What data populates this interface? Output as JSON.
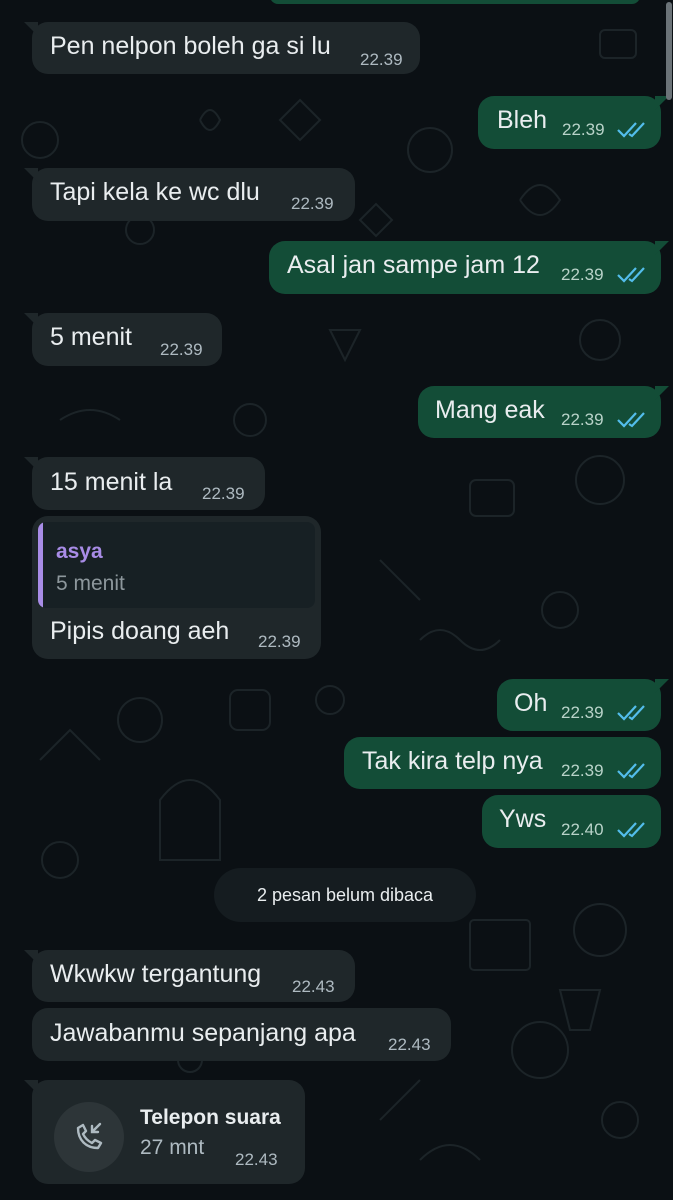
{
  "colors": {
    "background": "#0b1014",
    "incoming_bubble": "#1f272a",
    "outgoing_bubble": "#134d37",
    "read_ticks": "#53bdeb",
    "quote_accent": "#a88ce6"
  },
  "messages": [
    {
      "text": "Pen nelpon boleh ga si lu",
      "time": "22.39"
    },
    {
      "text": "Bleh",
      "time": "22.39"
    },
    {
      "text": "Tapi kela ke wc dlu",
      "time": "22.39"
    },
    {
      "text": "Asal jan sampe jam 12",
      "time": "22.39"
    },
    {
      "text": "5 menit",
      "time": "22.39"
    },
    {
      "text": "Mang eak",
      "time": "22.39"
    },
    {
      "text": "15 menit la",
      "time": "22.39"
    },
    {
      "quote_name": "asya",
      "quote_text": "5 menit",
      "text": "Pipis doang aeh",
      "time": "22.39"
    },
    {
      "text": "Oh",
      "time": "22.39"
    },
    {
      "text": "Tak kira telp nya",
      "time": "22.39"
    },
    {
      "text": "Yws",
      "time": "22.40"
    },
    {
      "text": "Wkwkw tergantung",
      "time": "22.43"
    },
    {
      "text": "Jawabanmu sepanjang apa",
      "time": "22.43"
    }
  ],
  "unread_banner": "2 pesan belum dibaca",
  "call": {
    "title": "Telepon suara",
    "duration": "27 mnt",
    "time": "22.43",
    "icon": "incoming-call-icon"
  }
}
